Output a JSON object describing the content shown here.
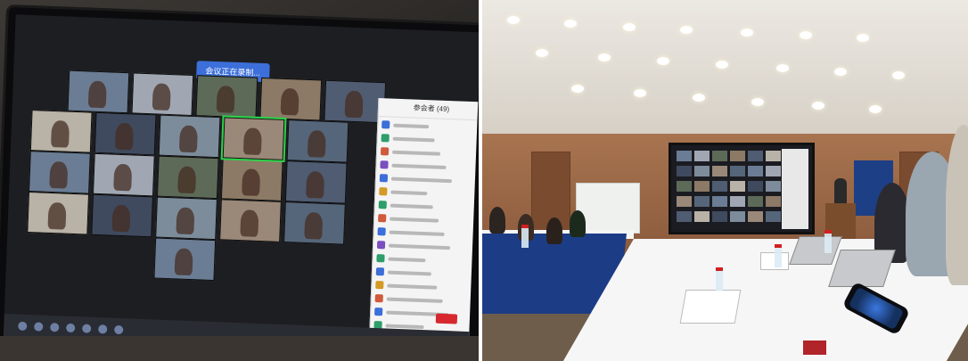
{
  "left_photo": {
    "banner": "会议正在录制...",
    "panel_title": "参会者 (49)",
    "leave_label": "结束"
  },
  "right_photo": {}
}
